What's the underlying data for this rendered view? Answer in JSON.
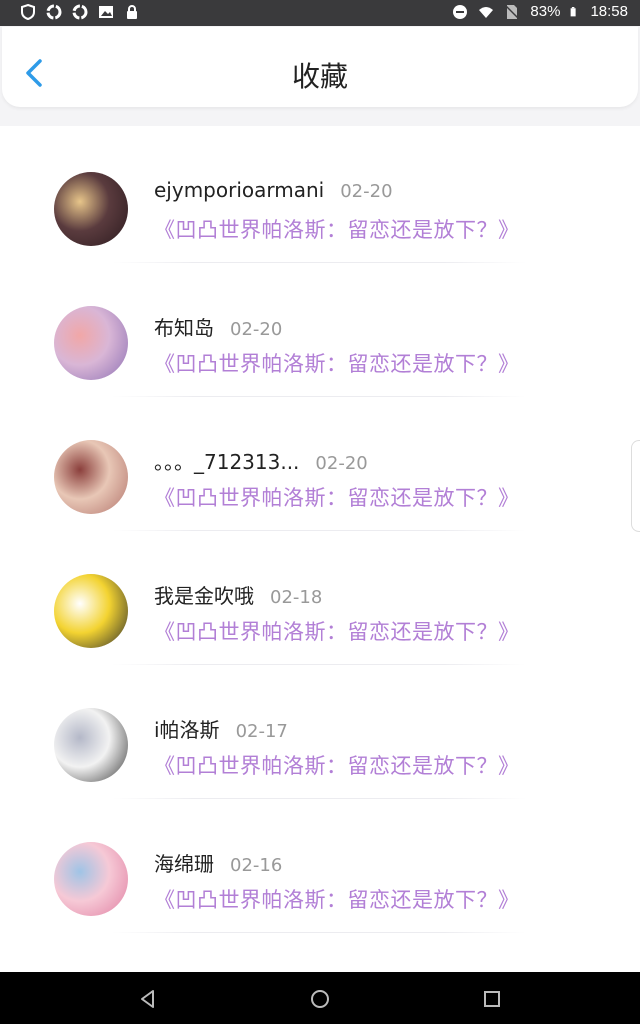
{
  "status_bar": {
    "battery": "83%",
    "time": "18:58"
  },
  "header": {
    "title": "收藏"
  },
  "items": [
    {
      "name": "ejymporioarmani",
      "date": "02-20",
      "quote": "《凹凸世界帕洛斯：留恋还是放下？》",
      "avatar_colors": [
        "#5a3b3e",
        "#2b1a1e",
        "#e7c58a"
      ]
    },
    {
      "name": "布知岛",
      "date": "02-20",
      "quote": "《凹凸世界帕洛斯：留恋还是放下？》",
      "avatar_colors": [
        "#d9b6d6",
        "#8c6fb3",
        "#f1a7a7"
      ]
    },
    {
      "name": "。。。_712313...",
      "date": "02-20",
      "quote": "《凹凸世界帕洛斯：留恋还是放下？》",
      "avatar_colors": [
        "#e8c7b6",
        "#b2736b",
        "#8b3f3c"
      ]
    },
    {
      "name": "我是金吹哦",
      "date": "02-18",
      "quote": "《凹凸世界帕洛斯：留恋还是放下？》",
      "avatar_colors": [
        "#f3d331",
        "#2b2b2b",
        "#ffffff"
      ]
    },
    {
      "name": "i帕洛斯",
      "date": "02-17",
      "quote": "《凹凸世界帕洛斯：留恋还是放下？》",
      "avatar_colors": [
        "#f2f2f2",
        "#3a3a3a",
        "#b4b8c8"
      ]
    },
    {
      "name": "海绵珊",
      "date": "02-16",
      "quote": "《凹凸世界帕洛斯：留恋还是放下？》",
      "avatar_colors": [
        "#f6c9d6",
        "#e07ea1",
        "#9fc4e6"
      ]
    }
  ],
  "nav": {
    "back_icon": "triangle-back",
    "home_icon": "circle-home",
    "recents_icon": "square-recents"
  },
  "colors": {
    "quote": "#b27fd6",
    "accent": "#2e9be8"
  }
}
